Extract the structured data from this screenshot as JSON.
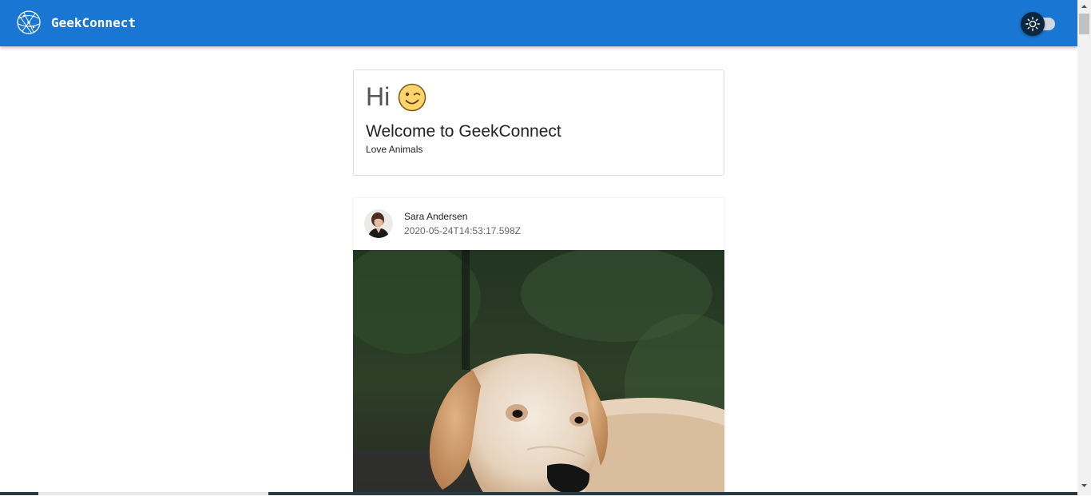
{
  "header": {
    "brand": "GeekConnect",
    "logo_icon": "globe-network-icon",
    "theme_toggle_icon": "sun-icon",
    "theme_toggle_on": false,
    "colors": {
      "appbar": "#1976d2",
      "toggle_knob": "#0d2740"
    }
  },
  "welcome": {
    "greeting": "Hi",
    "emoji_icon": "winking-face-icon",
    "title": "Welcome to GeekConnect",
    "subtitle": "Love Animals"
  },
  "post": {
    "author": "Sara Andersen",
    "timestamp": "2020-05-24T14:53:17.598Z",
    "avatar_icon": "user-avatar",
    "image_subject": "golden-retriever-photo"
  }
}
